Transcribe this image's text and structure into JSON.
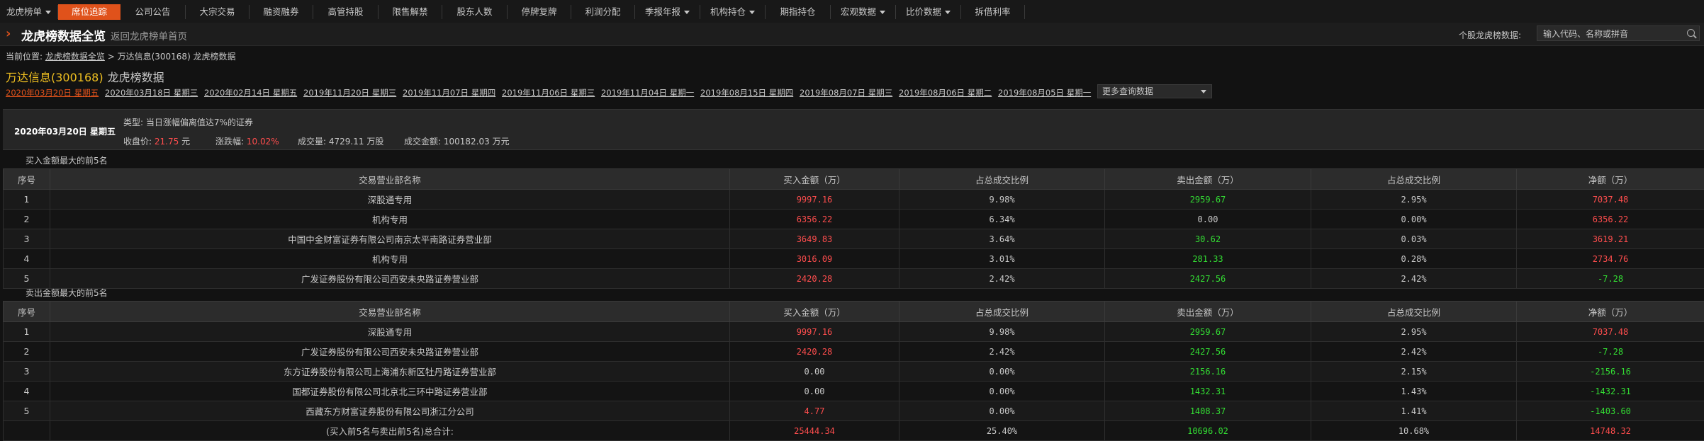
{
  "nav": {
    "items": [
      {
        "label": "龙虎榜单",
        "dropdown": true
      },
      {
        "label": "席位追踪",
        "active": true
      },
      {
        "label": "公司公告"
      },
      {
        "label": "大宗交易"
      },
      {
        "label": "融资融券"
      },
      {
        "label": "高管持股"
      },
      {
        "label": "限售解禁"
      },
      {
        "label": "股东人数"
      },
      {
        "label": "停牌复牌"
      },
      {
        "label": "利润分配"
      },
      {
        "label": "季报年报",
        "dropdown": true
      },
      {
        "label": "机构持仓",
        "dropdown": true
      },
      {
        "label": "期指持仓"
      },
      {
        "label": "宏观数据",
        "dropdown": true
      },
      {
        "label": "比价数据",
        "dropdown": true
      },
      {
        "label": "拆借利率"
      }
    ]
  },
  "header": {
    "title": "龙虎榜数据全览",
    "back_link": "返回龙虎榜单首页",
    "search_label": "个股龙虎榜数据:",
    "search_placeholder": "输入代码、名称或拼音"
  },
  "breadcrumb": {
    "prefix": "当前位置:",
    "link": "龙虎榜数据全览",
    "rest": " > 万达信息(300168) 龙虎榜数据"
  },
  "stock": {
    "name": "万达信息(300168)",
    "subtitle": "龙虎榜数据"
  },
  "dates": [
    {
      "label": "2020年03月20日 星期五",
      "active": true
    },
    {
      "label": "2020年03月18日 星期三"
    },
    {
      "label": "2020年02月14日 星期五"
    },
    {
      "label": "2019年11月20日 星期三"
    },
    {
      "label": "2019年11月07日 星期四"
    },
    {
      "label": "2019年11月06日 星期三"
    },
    {
      "label": "2019年11月04日 星期一"
    },
    {
      "label": "2019年08月15日 星期四"
    },
    {
      "label": "2019年08月07日 星期三"
    },
    {
      "label": "2019年08月06日 星期二"
    },
    {
      "label": "2019年08月05日 星期一"
    }
  ],
  "more_select": "更多查询数据",
  "summary": {
    "date": "2020年03月20日 星期五",
    "type": "类型: 当日涨幅偏离值达7%的证券",
    "close_label": "收盘价:",
    "close_value": "21.75",
    "close_unit": "元",
    "change_label": "涨跌幅:",
    "change_value": "10.02%",
    "volume_label": "成交量:",
    "volume_value": "4729.11",
    "volume_unit": "万股",
    "amount_label": "成交金额:",
    "amount_value": "100182.03",
    "amount_unit": "万元"
  },
  "columns": [
    "序号",
    "交易营业部名称",
    "买入金额（万）",
    "占总成交比例",
    "卖出金额（万）",
    "占总成交比例",
    "净额（万）"
  ],
  "buy": {
    "title": "买入金额最大的前5名",
    "rows": [
      [
        "1",
        "深股通专用",
        "9997.16",
        "9.98%",
        "2959.67",
        "2.95%",
        "7037.48"
      ],
      [
        "2",
        "机构专用",
        "6356.22",
        "6.34%",
        "0.00",
        "0.00%",
        "6356.22"
      ],
      [
        "3",
        "中国中金财富证券有限公司南京太平南路证券营业部",
        "3649.83",
        "3.64%",
        "30.62",
        "0.03%",
        "3619.21"
      ],
      [
        "4",
        "机构专用",
        "3016.09",
        "3.01%",
        "281.33",
        "0.28%",
        "2734.76"
      ],
      [
        "5",
        "广发证券股份有限公司西安未央路证券营业部",
        "2420.28",
        "2.42%",
        "2427.56",
        "2.42%",
        "-7.28"
      ]
    ]
  },
  "sell": {
    "title": "卖出金额最大的前5名",
    "rows": [
      [
        "1",
        "深股通专用",
        "9997.16",
        "9.98%",
        "2959.67",
        "2.95%",
        "7037.48"
      ],
      [
        "2",
        "广发证券股份有限公司西安未央路证券营业部",
        "2420.28",
        "2.42%",
        "2427.56",
        "2.42%",
        "-7.28"
      ],
      [
        "3",
        "东方证券股份有限公司上海浦东新区牡丹路证券营业部",
        "0.00",
        "0.00%",
        "2156.16",
        "2.15%",
        "-2156.16"
      ],
      [
        "4",
        "国都证券股份有限公司北京北三环中路证券营业部",
        "0.00",
        "0.00%",
        "1432.31",
        "1.43%",
        "-1432.31"
      ],
      [
        "5",
        "西藏东方财富证券股份有限公司浙江分公司",
        "4.77",
        "0.00%",
        "1408.37",
        "1.41%",
        "-1403.60"
      ]
    ],
    "total": [
      "",
      "(买入前5名与卖出前5名)总合计:",
      "25444.34",
      "25.40%",
      "10696.02",
      "10.68%",
      "14748.32"
    ]
  },
  "colors": {
    "accent": "#e0521b",
    "buy": "#ff4d4d",
    "sell": "#33dd33"
  }
}
